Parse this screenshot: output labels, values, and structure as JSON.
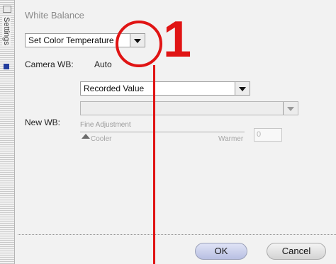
{
  "sidebar": {
    "tab_label": "Settings"
  },
  "panel": {
    "title": "White Balance",
    "mode_select": {
      "value": "Set Color Temperature"
    },
    "camera_wb": {
      "label": "Camera WB:",
      "value": "Auto"
    },
    "value_select": {
      "value": "Recorded Value"
    },
    "new_wb": {
      "label": "New WB:",
      "fine_adjustment_label": "Fine Adjustment",
      "cooler_label": "Cooler",
      "warmer_label": "Warmer",
      "fine_value": "0"
    }
  },
  "buttons": {
    "ok": "OK",
    "cancel": "Cancel"
  },
  "annotation": {
    "number": "1",
    "color": "#e01414"
  },
  "colors": {
    "panel_bg": "#f2f2f2",
    "ok_button": "#c8cdee"
  }
}
